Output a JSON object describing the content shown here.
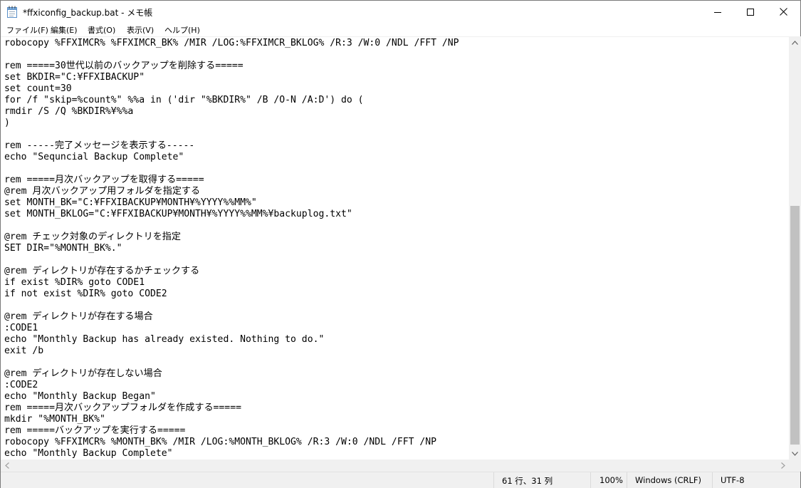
{
  "window": {
    "title": "*ffxiconfig_backup.bat - メモ帳"
  },
  "menu": {
    "items": [
      {
        "label": "ファイル(F)"
      },
      {
        "label": "編集(E)"
      },
      {
        "label": "書式(O)"
      },
      {
        "label": "表示(V)"
      },
      {
        "label": "ヘルプ(H)"
      }
    ]
  },
  "editor": {
    "lines": [
      "robocopy %FFXIMCR% %FFXIMCR_BK% /MIR /LOG:%FFXIMCR_BKLOG% /R:3 /W:0 /NDL /FFT /NP",
      "",
      "rem =====30世代以前のバックアップを削除する=====",
      "set BKDIR=\"C:¥FFXIBACKUP\"",
      "set count=30",
      "for /f \"skip=%count%\" %%a in ('dir \"%BKDIR%\" /B /O-N /A:D') do (",
      "rmdir /S /Q %BKDIR%¥%%a",
      ")",
      "",
      "rem -----完了メッセージを表示する-----",
      "echo \"Sequncial Backup Complete\"",
      "",
      "rem =====月次バックアップを取得する=====",
      "@rem 月次バックアップ用フォルダを指定する",
      "set MONTH_BK=\"C:¥FFXIBACKUP¥MONTH¥%YYYY%%MM%\"",
      "set MONTH_BKLOG=\"C:¥FFXIBACKUP¥MONTH¥%YYYY%%MM%¥backuplog.txt\"",
      "",
      "@rem チェック対象のディレクトリを指定",
      "SET DIR=\"%MONTH_BK%.\"",
      "",
      "@rem ディレクトリが存在するかチェックする",
      "if exist %DIR% goto CODE1",
      "if not exist %DIR% goto CODE2",
      "",
      "@rem ディレクトリが存在する場合",
      ":CODE1",
      "echo \"Monthly Backup has already existed. Nothing to do.\"",
      "exit /b",
      "",
      "@rem ディレクトリが存在しない場合",
      ":CODE2",
      "echo \"Monthly Backup Began\"",
      "rem =====月次バックアップフォルダを作成する=====",
      "mkdir \"%MONTH_BK%\"",
      "rem =====バックアップを実行する=====",
      "robocopy %FFXIMCR% %MONTH_BK% /MIR /LOG:%MONTH_BKLOG% /R:3 /W:0 /NDL /FFT /NP",
      "echo \"Monthly Backup Complete\""
    ]
  },
  "status": {
    "position": "61 行、31 列",
    "zoom": "100%",
    "line_ending": "Windows (CRLF)",
    "encoding": "UTF-8"
  }
}
